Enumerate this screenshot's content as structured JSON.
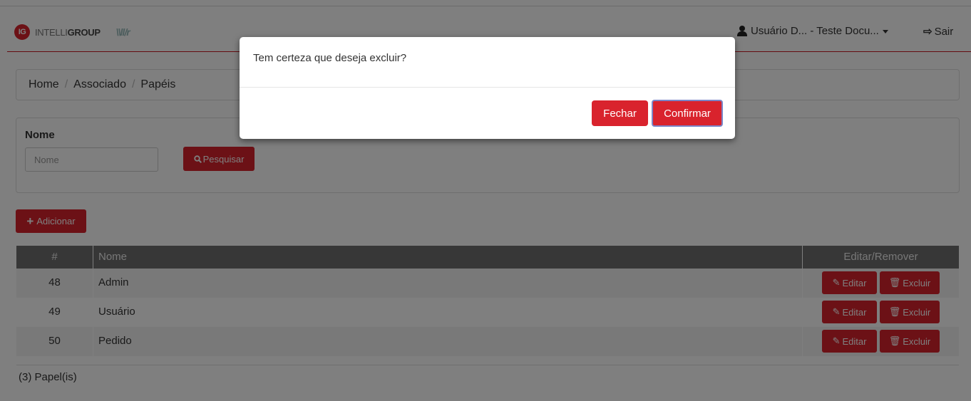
{
  "brand": {
    "badge": "IG",
    "name_light": "INTELLI",
    "name_bold": "GROUP",
    "mark": "\\\\ll/r"
  },
  "header": {
    "user_label": "Usuário D... - Teste Docu...",
    "logout_label": "Sair"
  },
  "breadcrumb": [
    "Home",
    "Associado",
    "Papéis"
  ],
  "filter": {
    "label": "Nome",
    "placeholder": "Nome",
    "value": "",
    "search_label": "Pesquisar"
  },
  "add_label": "Adicionar",
  "table": {
    "headers": {
      "id": "#",
      "name": "Nome",
      "actions": "Editar/Remover"
    },
    "edit_label": "Editar",
    "delete_label": "Excluir",
    "rows": [
      {
        "id": "48",
        "name": "Admin"
      },
      {
        "id": "49",
        "name": "Usuário"
      },
      {
        "id": "50",
        "name": "Pedido"
      }
    ]
  },
  "count_label": "(3) Papel(is)",
  "modal": {
    "message": "Tem certeza que deseja excluir?",
    "close_label": "Fechar",
    "confirm_label": "Confirmar"
  },
  "colors": {
    "accent": "#d9232d",
    "overlay": "rgba(0,0,0,0.5)",
    "table_header": "#6f6f6f"
  },
  "icons": {
    "user": "user-icon",
    "logout": "sign-out-icon",
    "search": "search-icon",
    "add": "plus-icon",
    "edit": "edit-icon",
    "delete": "trash-icon"
  }
}
